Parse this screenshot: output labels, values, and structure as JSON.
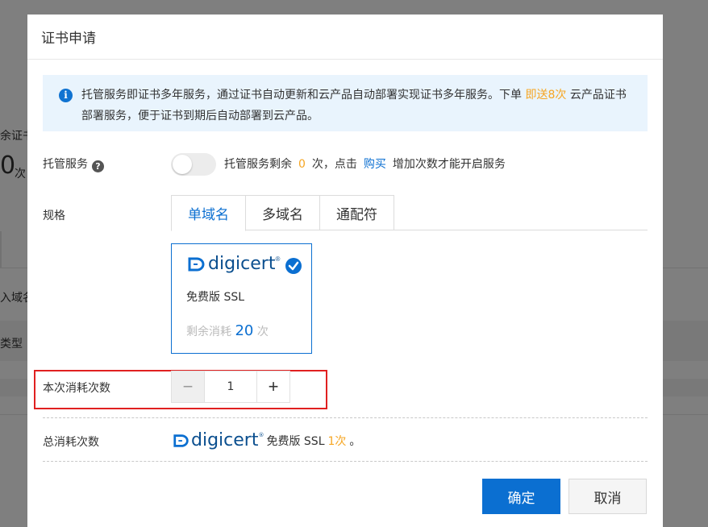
{
  "background": {
    "frag_cert": "余证书",
    "frag_zero": "0",
    "frag_times": "次",
    "frag_domain": "入域名",
    "frag_type": "类型"
  },
  "dialog": {
    "title": "证书申请",
    "notice": {
      "part1": "托管服务即证书多年服务，通过证书自动更新和云产品自动部署实现证书多年服务。下单 ",
      "highlight": "即送8次",
      "part2": " 云产品证书部署服务，便于证书到期后自动部署到云产品。"
    },
    "hosting": {
      "label": "托管服务",
      "help_icon": "?",
      "enabled": false,
      "text_prefix": "托管服务剩余",
      "remaining": "0",
      "text_mid": "次，点击",
      "buy_link": "购买",
      "text_suffix": "增加次数才能开启服务"
    },
    "spec": {
      "label": "规格",
      "tabs": [
        {
          "label": "单域名",
          "active": true
        },
        {
          "label": "多域名",
          "active": false
        },
        {
          "label": "通配符",
          "active": false
        }
      ]
    },
    "product_card": {
      "brand": "digicert",
      "name": "免费版 SSL",
      "remain_label": "剩余消耗",
      "remain_count": "20",
      "remain_unit": "次",
      "selected": true
    },
    "consume": {
      "label": "本次消耗次数",
      "value": "1",
      "minus": "−",
      "plus": "+"
    },
    "total": {
      "label": "总消耗次数",
      "brand": "digicert",
      "product": "免费版 SSL",
      "count": "1次",
      "end": "。"
    },
    "buttons": {
      "ok": "确定",
      "cancel": "取消"
    },
    "colors": {
      "primary": "#0b6fd1",
      "highlight": "#f6a623",
      "annotation": "#e02020",
      "notice_bg": "#e9f4fd"
    },
    "icons": [
      "info-icon",
      "help-icon",
      "check-icon",
      "digicert-logo",
      "minus-icon",
      "plus-icon"
    ]
  }
}
